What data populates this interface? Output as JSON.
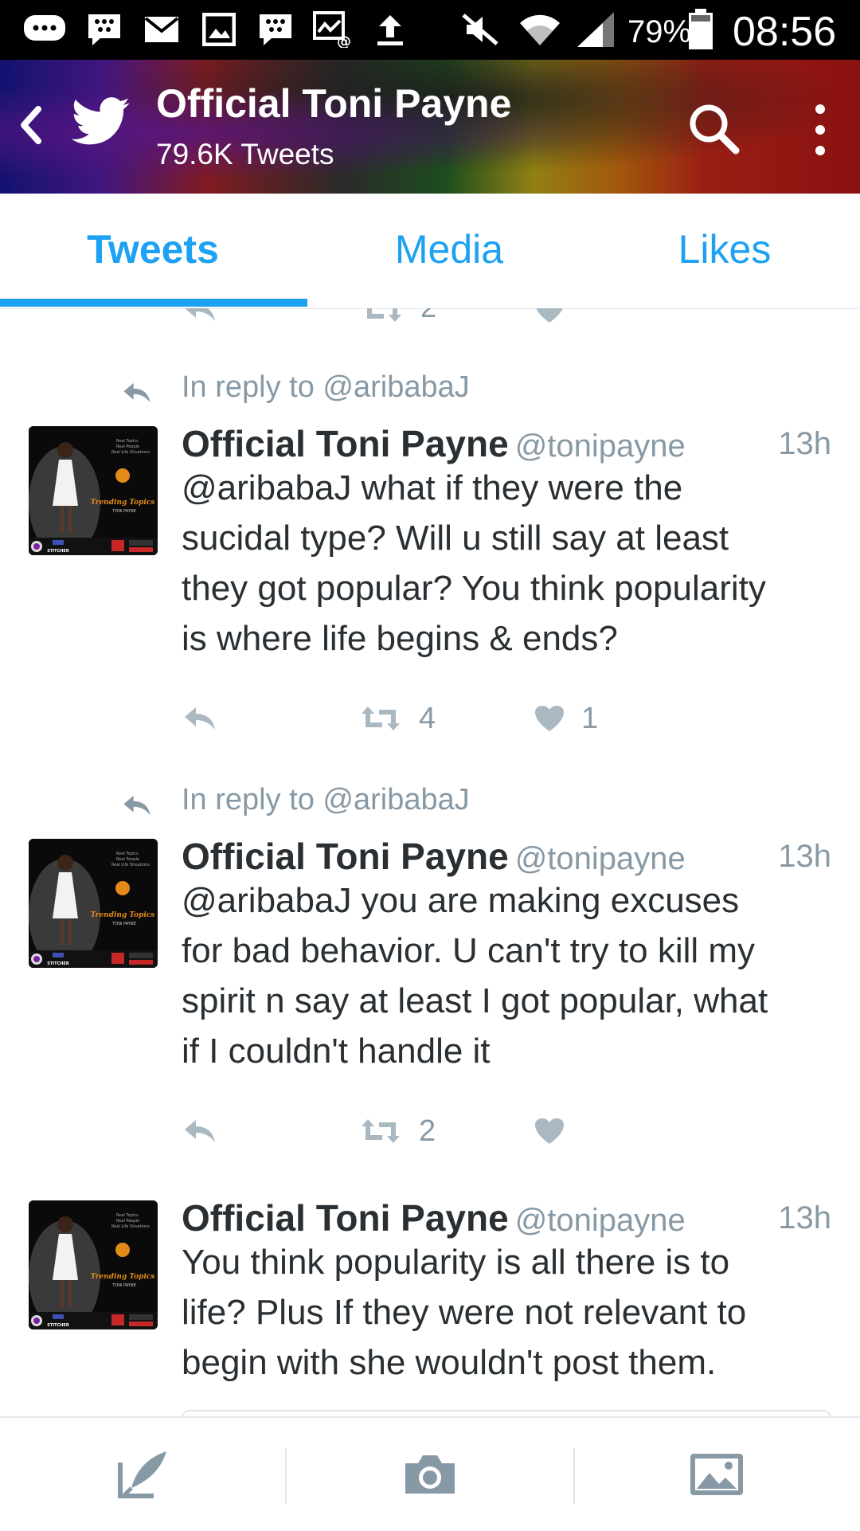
{
  "status_bar": {
    "battery": "79%",
    "time": "08:56",
    "icons": [
      "chat-bubble-icon",
      "bbm-icon",
      "mail-icon",
      "gallery-icon",
      "bbm-icon",
      "email-attach-icon",
      "upload-icon",
      "mute-icon",
      "wifi-icon",
      "signal-icon",
      "battery-icon"
    ]
  },
  "header": {
    "title": "Official Toni Payne",
    "subtitle": "79.6K Tweets"
  },
  "tabs": [
    {
      "label": "Tweets",
      "active": true
    },
    {
      "label": "Media",
      "active": false
    },
    {
      "label": "Likes",
      "active": false
    }
  ],
  "peek": {
    "retweet_count": "2"
  },
  "tweets": [
    {
      "reply_to": "In reply to @aribabaJ",
      "name": "Official Toni Payne",
      "handle": "@tonipayne",
      "time": "13h",
      "lines": [
        "@aribabaJ what if they were the",
        "sucidal type? Will u still say at least",
        "they got popular? You think popularity",
        "is where life begins & ends?"
      ],
      "retweets": "4",
      "likes": "1"
    },
    {
      "reply_to": "In reply to @aribabaJ",
      "name": "Official Toni Payne",
      "handle": "@tonipayne",
      "time": "13h",
      "lines": [
        "@aribabaJ you are making excuses",
        "for bad behavior. U can't try to kill my",
        "spirit n say at least I got popular, what",
        "if I couldn't handle it"
      ],
      "retweets": "2",
      "likes": ""
    },
    {
      "reply_to": "",
      "name": "Official Toni Payne",
      "handle": "@tonipayne",
      "time": "13h",
      "lines": [
        "You think popularity is all there is to",
        "life? Plus If they were not relevant to",
        "begin with she wouldn't post them."
      ],
      "retweets": "",
      "likes": ""
    }
  ],
  "avatar": {
    "lines": [
      "Real Topics",
      "Real People",
      "Real Life Situations"
    ],
    "brand": "Trending Topics",
    "host": "TONI PAYNE",
    "footer": "STITCHER"
  },
  "colors": {
    "accent": "#1da1f2",
    "muted": "#8899a6",
    "text": "#292f33",
    "divider": "#e1e8ed"
  },
  "bottom_bar": {
    "icons": [
      "compose-tweet-icon",
      "camera-icon",
      "photo-icon"
    ]
  }
}
